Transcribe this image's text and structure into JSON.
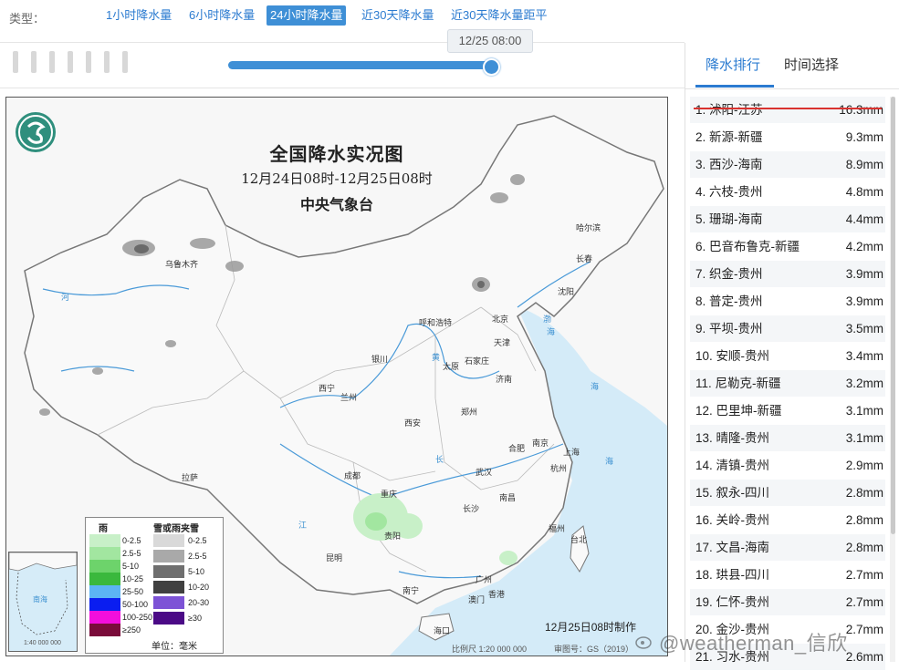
{
  "type_selector": {
    "label": "类型：",
    "tabs": [
      {
        "label": "1小时降水量",
        "active": false
      },
      {
        "label": "6小时降水量",
        "active": false
      },
      {
        "label": "24小时降水量",
        "active": true
      },
      {
        "label": "近30天降水量",
        "active": false
      },
      {
        "label": "近30天降水量距平",
        "active": false
      }
    ]
  },
  "timeline": {
    "current_time": "12/25 08:00"
  },
  "map": {
    "title": "全国降水实况图",
    "period": "12月24日08时-12月25日08时",
    "agency": "中央气象台",
    "made_time": "12月25日08时制作",
    "scale": "比例尺 1:20 000 000",
    "review_mark": "审图号：GS（2019）",
    "cities": [
      "乌鲁木齐",
      "哈尔滨",
      "长春",
      "沈阳",
      "呼和浩特",
      "北京",
      "天津",
      "银川",
      "太原",
      "石家庄",
      "济南",
      "西宁",
      "兰州",
      "西安",
      "郑州",
      "南京",
      "合肥",
      "上海",
      "杭州",
      "武汉",
      "成都",
      "重庆",
      "长沙",
      "南昌",
      "拉萨",
      "贵阳",
      "昆明",
      "福州",
      "台北",
      "南宁",
      "广州",
      "澳门",
      "香港",
      "海口"
    ],
    "rivers": [
      "河",
      "海",
      "江",
      "长",
      "黄",
      "渤",
      "海",
      "海"
    ],
    "inset": {
      "label": "南海",
      "scale": "1:40 000 000"
    },
    "legend": {
      "rain_header": "雨",
      "snow_header": "雪或雨夹雪",
      "rain": [
        {
          "label": "0-2.5",
          "color": "#c8f0c8"
        },
        {
          "label": "2.5-5",
          "color": "#a2e6a0"
        },
        {
          "label": "5-10",
          "color": "#6dd36b"
        },
        {
          "label": "10-25",
          "color": "#3ab83d"
        },
        {
          "label": "25-50",
          "color": "#5cb4f4"
        },
        {
          "label": "50-100",
          "color": "#0a1df0"
        },
        {
          "label": "100-250",
          "color": "#f20fdc"
        },
        {
          "label": "≥250",
          "color": "#7a0c3a"
        }
      ],
      "snow": [
        {
          "label": "0-2.5",
          "color": "#d9d9d9"
        },
        {
          "label": "2.5-5",
          "color": "#a9a9a9"
        },
        {
          "label": "5-10",
          "color": "#6f6f6f"
        },
        {
          "label": "10-20",
          "color": "#404040"
        },
        {
          "label": "20-30",
          "color": "#7d53d6"
        },
        {
          "label": "≥30",
          "color": "#4b0a86"
        }
      ],
      "unit": "单位：毫米"
    }
  },
  "right_panel": {
    "tabs": [
      {
        "label": "降水排行",
        "active": true
      },
      {
        "label": "时间选择",
        "active": false
      }
    ],
    "ranking": [
      {
        "name": "1. 沭阳-江苏",
        "value": "16.3mm",
        "struck": true
      },
      {
        "name": "2. 新源-新疆",
        "value": "9.3mm"
      },
      {
        "name": "3. 西沙-海南",
        "value": "8.9mm"
      },
      {
        "name": "4. 六枝-贵州",
        "value": "4.8mm"
      },
      {
        "name": "5. 珊瑚-海南",
        "value": "4.4mm"
      },
      {
        "name": "6. 巴音布鲁克-新疆",
        "value": "4.2mm"
      },
      {
        "name": "7. 织金-贵州",
        "value": "3.9mm"
      },
      {
        "name": "8. 普定-贵州",
        "value": "3.9mm"
      },
      {
        "name": "9. 平坝-贵州",
        "value": "3.5mm"
      },
      {
        "name": "10. 安顺-贵州",
        "value": "3.4mm"
      },
      {
        "name": "11. 尼勒克-新疆",
        "value": "3.2mm"
      },
      {
        "name": "12. 巴里坤-新疆",
        "value": "3.1mm"
      },
      {
        "name": "13. 晴隆-贵州",
        "value": "3.1mm"
      },
      {
        "name": "14. 清镇-贵州",
        "value": "2.9mm"
      },
      {
        "name": "15. 叙永-四川",
        "value": "2.8mm"
      },
      {
        "name": "16. 关岭-贵州",
        "value": "2.8mm"
      },
      {
        "name": "17. 文昌-海南",
        "value": "2.8mm"
      },
      {
        "name": "18. 珙县-四川",
        "value": "2.7mm"
      },
      {
        "name": "19. 仁怀-贵州",
        "value": "2.7mm"
      },
      {
        "name": "20. 金沙-贵州",
        "value": "2.7mm"
      },
      {
        "name": "21. 习水-贵州",
        "value": "2.6mm"
      }
    ]
  },
  "watermark": "@weatherman_信欣"
}
